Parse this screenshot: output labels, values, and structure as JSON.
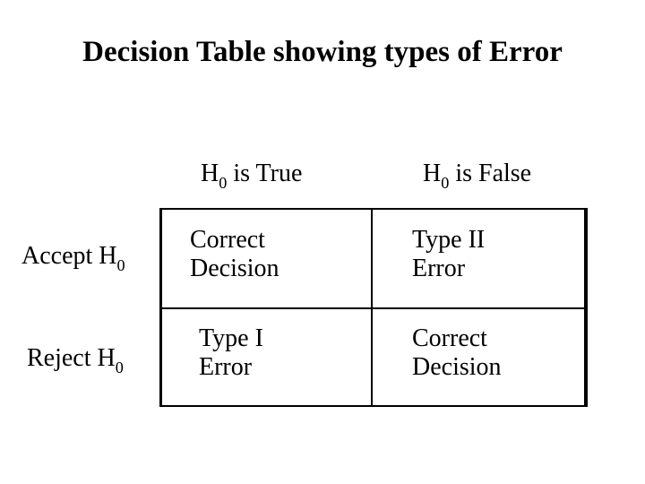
{
  "title_html": "Decision Table showing types of Error",
  "col_headers": [
    "H<sub>0</sub> is True",
    "H<sub>0</sub> is False"
  ],
  "row_headers": [
    "Accept H<sub>0</sub>",
    "Reject H<sub>0</sub>"
  ],
  "cells": [
    [
      "Correct<br>Decision",
      "Type II<br>Error"
    ],
    [
      "Type I<br>Error",
      "Correct<br>Decision"
    ]
  ]
}
